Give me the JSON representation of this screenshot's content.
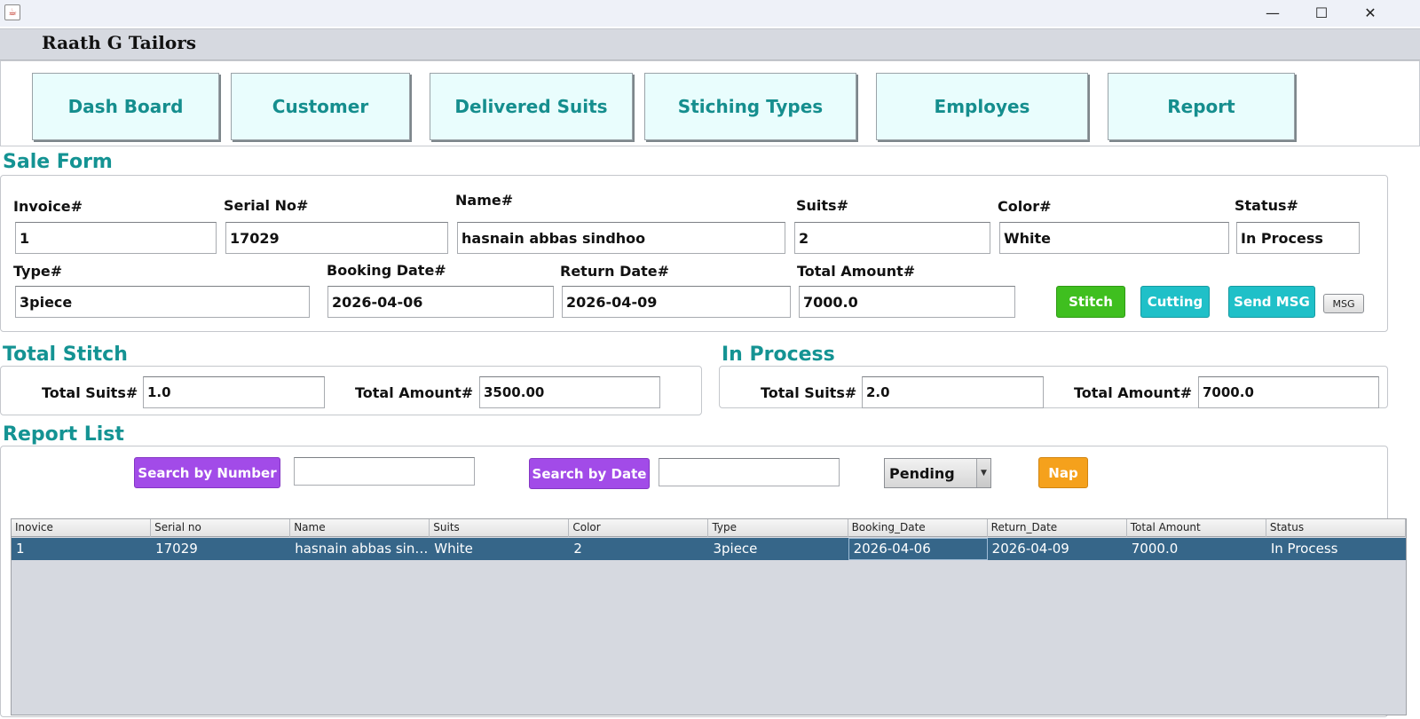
{
  "window": {
    "minimize": "—",
    "maximize": "☐",
    "close": "✕"
  },
  "app": {
    "title": "Raath G Tailors"
  },
  "nav": [
    {
      "label": "Dash Board"
    },
    {
      "label": "Customer"
    },
    {
      "label": "Delivered Suits"
    },
    {
      "label": "Stiching Types"
    },
    {
      "label": "Employes"
    },
    {
      "label": "Report"
    }
  ],
  "sale_form": {
    "title": "Sale Form",
    "invoice": {
      "label": "Invoice#",
      "value": "1"
    },
    "serial": {
      "label": "Serial No#",
      "value": "17029"
    },
    "name": {
      "label": "Name#",
      "value": "hasnain abbas sindhoo"
    },
    "suits": {
      "label": "Suits#",
      "value": "2"
    },
    "color": {
      "label": "Color#",
      "value": "White"
    },
    "status": {
      "label": "Status#",
      "value": "In Process"
    },
    "type": {
      "label": "Type#",
      "value": "3piece"
    },
    "booking_date": {
      "label": "Booking Date#",
      "value": "2026-04-06"
    },
    "return_date": {
      "label": "Return Date#",
      "value": "2026-04-09"
    },
    "total_amount": {
      "label": "Total Amount#",
      "value": "7000.0"
    },
    "buttons": {
      "stitch": "Stitch",
      "cutting": "Cutting",
      "send_msg": "Send MSG",
      "msg": "MSG"
    }
  },
  "total_stitch": {
    "title": "Total Stitch",
    "suits_label": "Total Suits#",
    "suits_value": "1.0",
    "amount_label": "Total Amount#",
    "amount_value": "3500.00"
  },
  "in_process": {
    "title": "In Process",
    "suits_label": "Total Suits#",
    "suits_value": "2.0",
    "amount_label": "Total Amount#",
    "amount_value": "7000.0"
  },
  "report_list": {
    "title": "Report List",
    "search_number_label": "Search by Number",
    "search_date_label": "Search by Date",
    "filter_selected": "Pending",
    "nap_label": "Nap",
    "columns": [
      "Inovice",
      "Serial no",
      "Name",
      "Suits",
      "Color",
      "Type",
      "Booking_Date",
      "Return_Date",
      "Total Amount",
      "Status"
    ],
    "rows": [
      [
        "1",
        "17029",
        "hasnain abbas sindhoo",
        "White",
        "2",
        "3piece",
        "2026-04-06",
        "2026-04-09",
        "7000.0",
        "In Process"
      ]
    ]
  },
  "colors": {
    "accent_teal": "#149393",
    "stitch_green": "#3fbf1f",
    "cutting_teal": "#1fc0c8",
    "search_purple": "#a24be8",
    "nap_orange": "#f5a11c",
    "selected_row": "#366689"
  },
  "icons": {
    "java": "java-icon",
    "dropdown": "chevron-down-icon"
  }
}
